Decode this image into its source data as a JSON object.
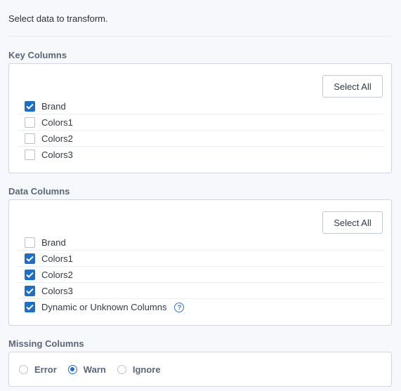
{
  "intro_text": "Select data to transform.",
  "key_columns": {
    "title": "Key Columns",
    "select_all_label": "Select All",
    "items": [
      {
        "label": "Brand",
        "checked": true
      },
      {
        "label": "Colors1",
        "checked": false
      },
      {
        "label": "Colors2",
        "checked": false
      },
      {
        "label": "Colors3",
        "checked": false
      }
    ]
  },
  "data_columns": {
    "title": "Data Columns",
    "select_all_label": "Select All",
    "items": [
      {
        "label": "Brand",
        "checked": false
      },
      {
        "label": "Colors1",
        "checked": true
      },
      {
        "label": "Colors2",
        "checked": true
      },
      {
        "label": "Colors3",
        "checked": true
      },
      {
        "label": "Dynamic or Unknown Columns",
        "checked": true,
        "help_icon": "?"
      }
    ]
  },
  "missing_columns": {
    "title": "Missing Columns",
    "options": [
      {
        "label": "Error",
        "selected": false
      },
      {
        "label": "Warn",
        "selected": true
      },
      {
        "label": "Ignore",
        "selected": false
      }
    ]
  },
  "colors": {
    "accent": "#1c6fc9",
    "section_title": "#5b6677",
    "panel_border": "#cfd6e2",
    "background": "#f7f8fc"
  }
}
